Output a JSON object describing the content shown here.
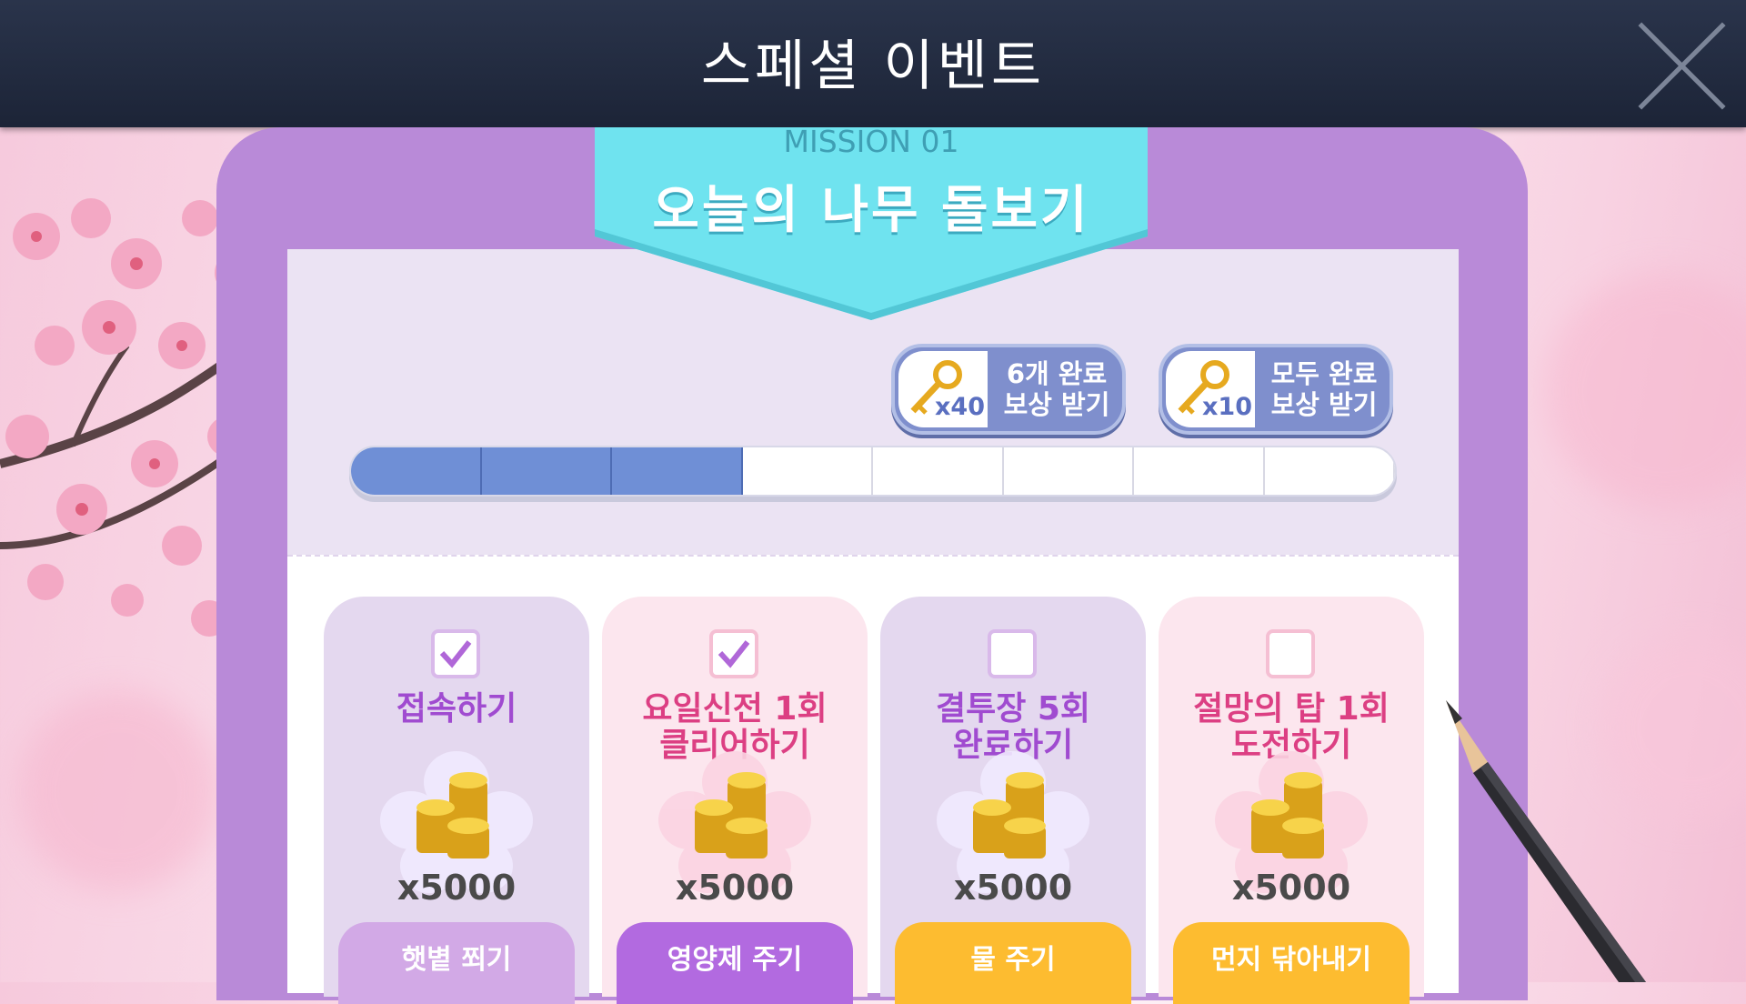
{
  "header": {
    "title": "스페셜 이벤트"
  },
  "mission": {
    "label": "MISSION 01",
    "title": "오늘의 나무 돌보기"
  },
  "rewards": [
    {
      "count": "x40",
      "label_line1": "6개 완료",
      "label_line2": "보상 받기"
    },
    {
      "count": "x10",
      "label_line1": "모두 완료",
      "label_line2": "보상 받기"
    }
  ],
  "progress": {
    "completed": 3,
    "total": 8,
    "fill_color": "#6f8fd6"
  },
  "tasks": [
    {
      "title_line1": "접속하기",
      "title_line2": "",
      "checked": true,
      "amount": "x5000",
      "button": "햇볕 쬐기"
    },
    {
      "title_line1": "요일신전 1회",
      "title_line2": "클리어하기",
      "checked": true,
      "amount": "x5000",
      "button": "영양제 주기"
    },
    {
      "title_line1": "결투장 5회",
      "title_line2": "완료하기",
      "checked": false,
      "amount": "x5000",
      "button": "물 주기"
    },
    {
      "title_line1": "절망의 탑 1회",
      "title_line2": "도전하기",
      "checked": false,
      "amount": "x5000",
      "button": "먼지 닦아내기"
    }
  ],
  "colors": {
    "header_bg": "#1f283b",
    "board": "#b98ad8",
    "ribbon": "#6fe3ef",
    "accent_yellow": "#fdbc30"
  },
  "icons": {
    "close": "close-icon",
    "key": "key-icon",
    "coin": "coin-stack-icon",
    "check": "check-icon"
  }
}
